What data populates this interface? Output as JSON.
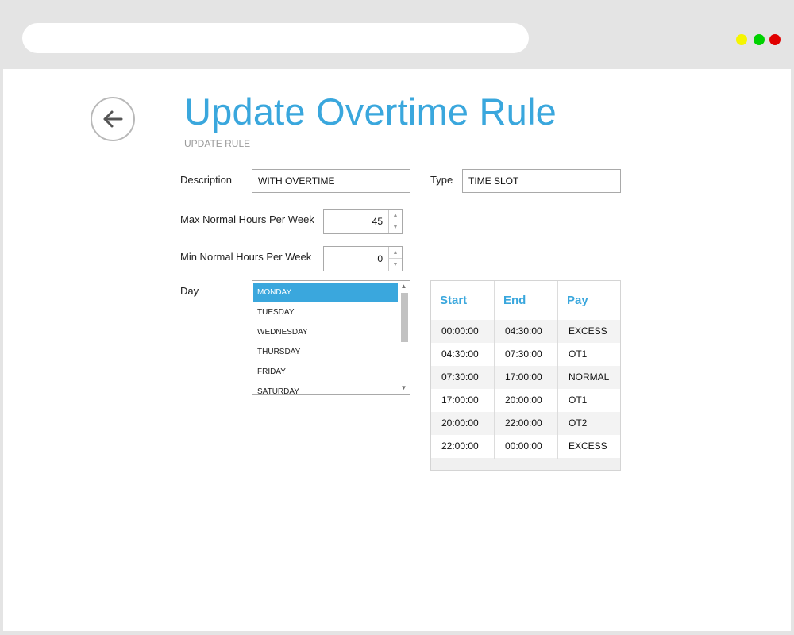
{
  "page": {
    "title": "Update Overtime Rule",
    "subtitle": "UPDATE RULE"
  },
  "form": {
    "description_label": "Description",
    "description_value": "WITH OVERTIME",
    "type_label": "Type",
    "type_value": "TIME SLOT",
    "max_hours_label": "Max Normal Hours Per Week",
    "max_hours_value": "45",
    "min_hours_label": "Min Normal Hours Per Week",
    "min_hours_value": "0",
    "day_label": "Day"
  },
  "days": {
    "selected": "MONDAY",
    "items": [
      "MONDAY",
      "TUESDAY",
      "WEDNESDAY",
      "THURSDAY",
      "FRIDAY",
      "SATURDAY"
    ]
  },
  "slots": {
    "headers": [
      "Start",
      "End",
      "Pay"
    ],
    "rows": [
      [
        "00:00:00",
        "04:30:00",
        "EXCESS"
      ],
      [
        "04:30:00",
        "07:30:00",
        "OT1"
      ],
      [
        "07:30:00",
        "17:00:00",
        "NORMAL"
      ],
      [
        "17:00:00",
        "20:00:00",
        "OT1"
      ],
      [
        "20:00:00",
        "22:00:00",
        "OT2"
      ],
      [
        "22:00:00",
        "00:00:00",
        "EXCESS"
      ]
    ]
  },
  "icons": {
    "back": "arrow-left-icon",
    "spin_up": "triangle-up-icon",
    "spin_down": "triangle-down-icon"
  },
  "colors": {
    "accent": "#3aa7dd",
    "window_traffic": [
      "#f5f500",
      "#00d200",
      "#e00000"
    ]
  }
}
